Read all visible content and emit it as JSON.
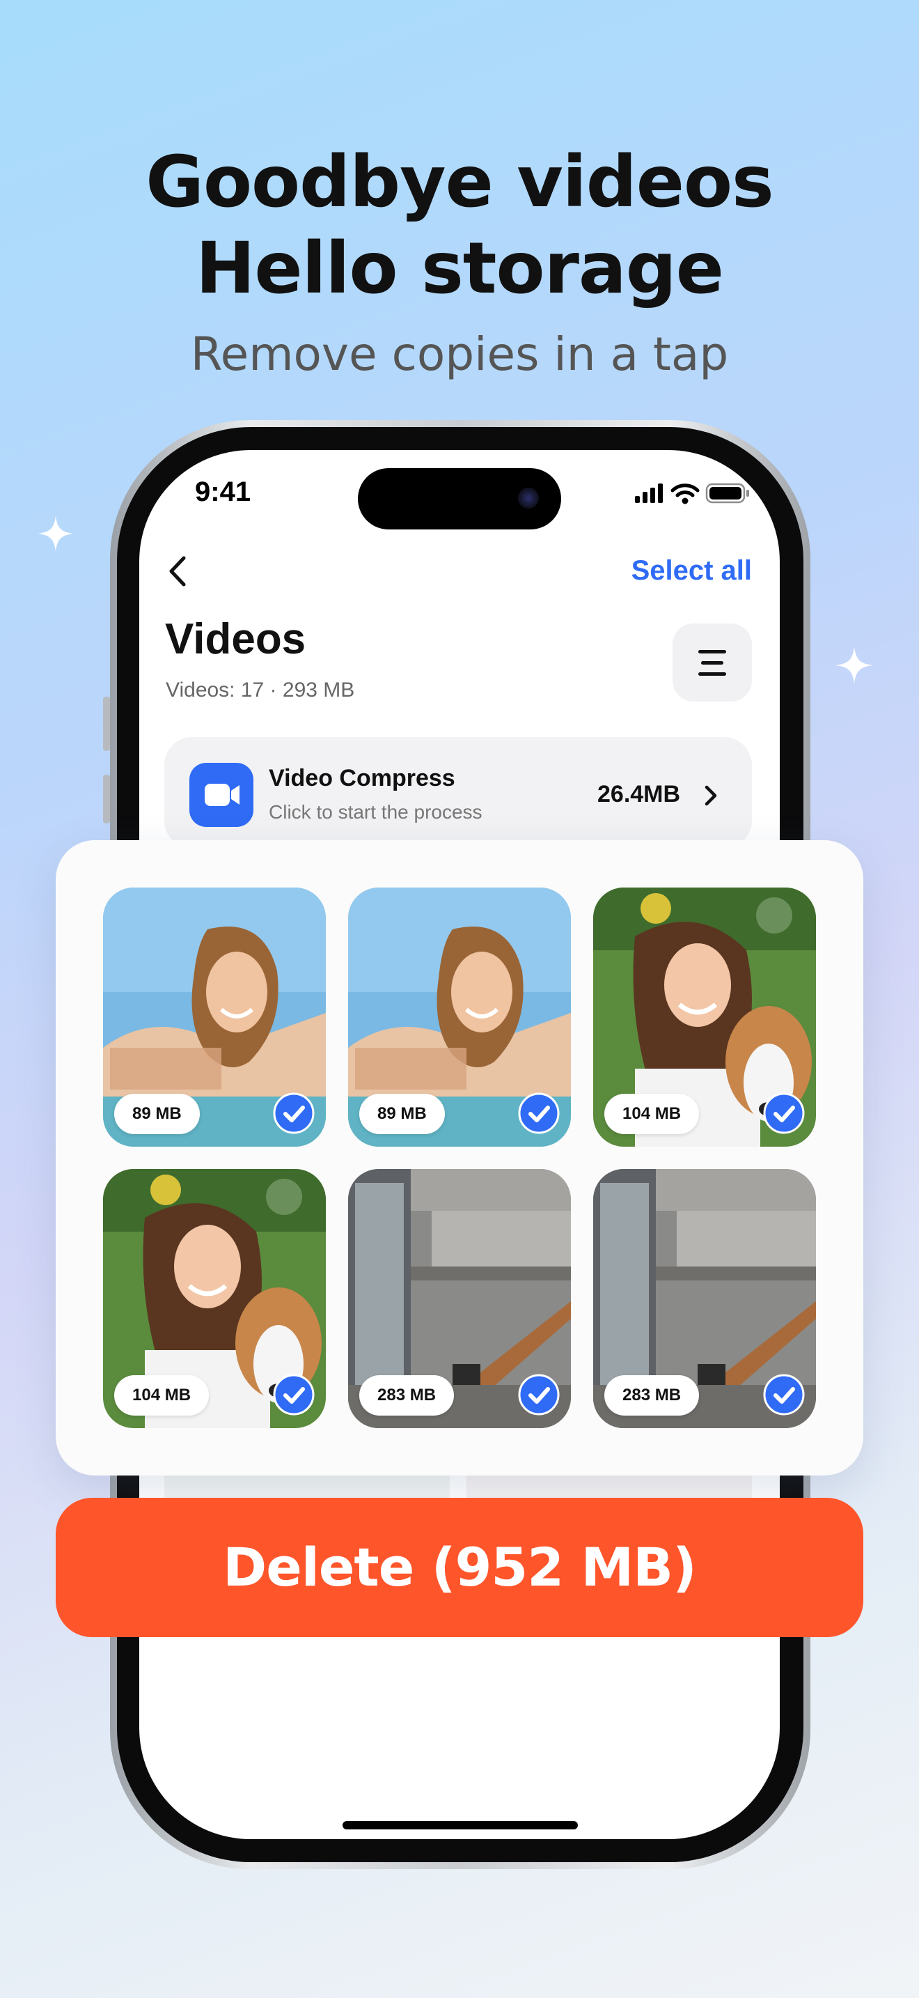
{
  "headline": {
    "line1": "Goodbye videos",
    "line2": "Hello storage"
  },
  "subheadline": "Remove copies in a tap",
  "status_bar": {
    "time": "9:41",
    "icons": [
      "signal-icon",
      "wifi-icon",
      "battery-icon"
    ]
  },
  "nav": {
    "back_icon": "chevron-left-icon",
    "select_all_label": "Select all"
  },
  "page": {
    "title": "Videos",
    "subtitle": "Videos: 17 · 293 MB",
    "menu_icon": "menu-icon"
  },
  "compress_card": {
    "title": "Video Compress",
    "subtitle": "Click to start the process",
    "size": "26.4MB",
    "icon": "video-camera-icon",
    "chevron_icon": "chevron-right-icon"
  },
  "videos": [
    {
      "size": "89 MB",
      "scene": "beach-selfie",
      "selected": true
    },
    {
      "size": "89 MB",
      "scene": "beach-selfie",
      "selected": true
    },
    {
      "size": "104 MB",
      "scene": "girl-with-dog",
      "selected": true
    },
    {
      "size": "104 MB",
      "scene": "girl-with-dog",
      "selected": true
    },
    {
      "size": "283 MB",
      "scene": "concrete-interior",
      "selected": true
    },
    {
      "size": "283 MB",
      "scene": "concrete-interior",
      "selected": true
    }
  ],
  "delete_button": {
    "label": "Delete (952 MB)"
  },
  "colors": {
    "accent_blue": "#2f6bf5",
    "delete_orange": "#ff552b",
    "text_dark": "#111111"
  }
}
